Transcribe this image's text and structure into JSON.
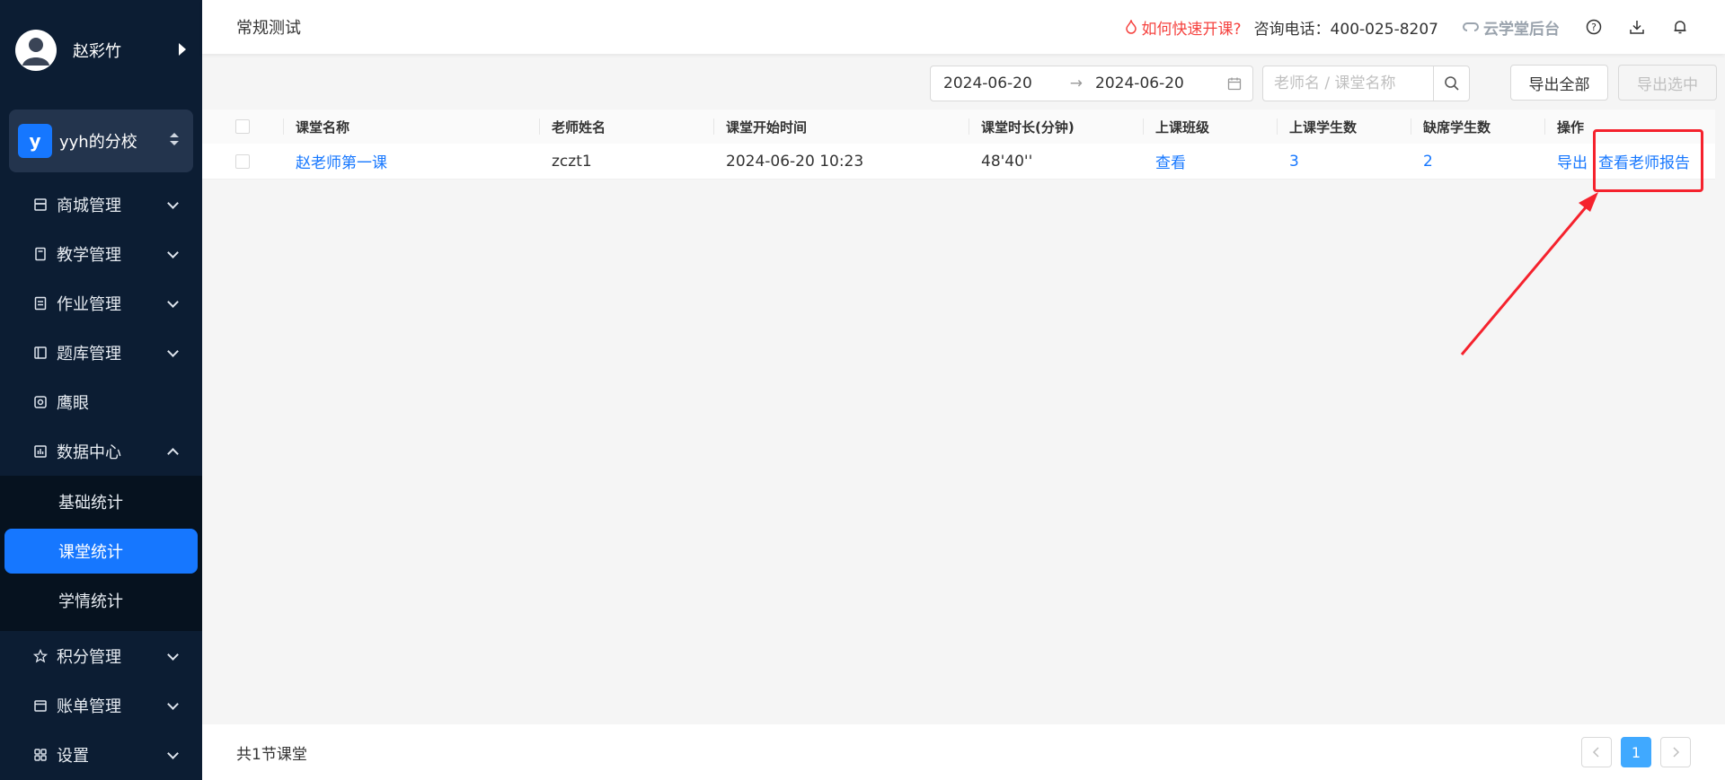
{
  "user": {
    "name": "赵彩竹",
    "avatar_icon": "user-avatar-icon"
  },
  "school": {
    "badge": "y",
    "name": "yyh的分校"
  },
  "menu": [
    {
      "label": "商城管理",
      "icon": "shop-icon"
    },
    {
      "label": "教学管理",
      "icon": "book-icon"
    },
    {
      "label": "作业管理",
      "icon": "homework-icon"
    },
    {
      "label": "题库管理",
      "icon": "question-bank-icon"
    },
    {
      "label": "鹰眼",
      "icon": "eagle-eye-icon"
    },
    {
      "label": "数据中心",
      "icon": "chart-icon"
    }
  ],
  "submenu": [
    {
      "label": "基础统计"
    },
    {
      "label": "课堂统计"
    },
    {
      "label": "学情统计"
    }
  ],
  "menu_bottom": [
    {
      "label": "积分管理",
      "icon": "star-icon"
    },
    {
      "label": "账单管理",
      "icon": "bill-icon"
    },
    {
      "label": "设置",
      "icon": "settings-icon"
    }
  ],
  "header": {
    "title": "常规测试",
    "promo": "如何快速开课?",
    "phone": "咨询电话：400-025-8207",
    "cloud": "云学堂后台"
  },
  "filter": {
    "date_start": "2024-06-20",
    "date_sep": "→",
    "date_end": "2024-06-20",
    "search_placeholder": "老师名 / 课堂名称",
    "export_all": "导出全部",
    "export_selected": "导出选中"
  },
  "table": {
    "columns": [
      "课堂名称",
      "老师姓名",
      "课堂开始时间",
      "课堂时长(分钟)",
      "上课班级",
      "上课学生数",
      "缺席学生数",
      "操作"
    ],
    "rows": [
      {
        "name": "赵老师第一课",
        "teacher": "zczt1",
        "start": "2024-06-20 10:23",
        "duration": "48'40''",
        "class_action": "查看",
        "students": "3",
        "absent": "2",
        "action_export": "导出",
        "action_report": "查看老师报告"
      }
    ]
  },
  "footer": {
    "total": "共1节课堂",
    "page": "1"
  },
  "colors": {
    "sidebar": "#0c1d33",
    "accent": "#1677ff",
    "promo": "#f5423f",
    "annotation": "#f5222d"
  }
}
